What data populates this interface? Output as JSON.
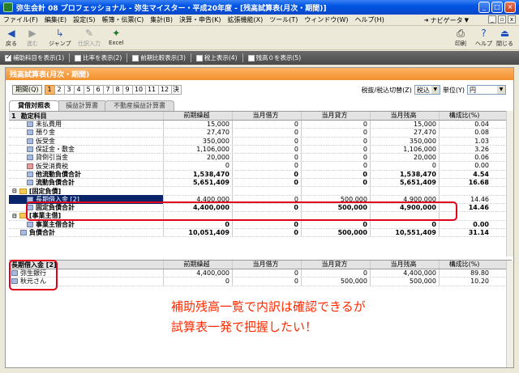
{
  "window": {
    "title": "弥生会計 08 プロフェッショナル - 弥生マイスター・平成20年度 - [残高試算表(月次・期間)]"
  },
  "menu": [
    "ファイル(F)",
    "編集(E)",
    "設定(S)",
    "帳簿・伝票(C)",
    "集計(B)",
    "決算・申告(K)",
    "拡張機能(X)",
    "ツール(T)",
    "ウィンドウ(W)",
    "ヘルプ(H)"
  ],
  "navigator": "ナビゲータ",
  "toolbar": {
    "back": "戻る",
    "forward": "進む",
    "jump": "ジャンプ",
    "open": "仕訳入力",
    "excel": "Excel",
    "print": "印刷",
    "help": "ヘルプ",
    "close": "閉じる"
  },
  "options": [
    "補助科目を表示(1)",
    "比率を表示(2)",
    "前期比較表示(3)",
    "税上表示(4)",
    "残高０を表示(5)"
  ],
  "panel_title": "残高試算表(月次・期間)",
  "period": {
    "button": "期間(Q)",
    "months": [
      "1",
      "2",
      "3",
      "4",
      "5",
      "6",
      "7",
      "8",
      "9",
      "10",
      "11",
      "12",
      "決"
    ]
  },
  "tax": {
    "label": "税抜/税込切替(Z)",
    "value": "税込",
    "unit_label": "単位(Y)",
    "unit_value": "円"
  },
  "tabs": [
    "貸借対照表",
    "損益計算書",
    "不動産損益計算書"
  ],
  "main": {
    "headers": [
      "勘定科目",
      "前期繰越",
      "当月借方",
      "当月貸方",
      "当月残高",
      "構成比(%)"
    ],
    "rows": [
      {
        "name": "未払費用",
        "v": [
          "15,000",
          "0",
          "0",
          "15,000",
          "0.04"
        ]
      },
      {
        "name": "預り金",
        "v": [
          "27,470",
          "0",
          "0",
          "27,470",
          "0.08"
        ]
      },
      {
        "name": "仮受金",
        "v": [
          "350,000",
          "0",
          "0",
          "350,000",
          "1.03"
        ]
      },
      {
        "name": "保証金・敷金",
        "v": [
          "1,106,000",
          "0",
          "0",
          "1,106,000",
          "3.26"
        ]
      },
      {
        "name": "貸倒引当金",
        "v": [
          "20,000",
          "0",
          "0",
          "20,000",
          "0.06"
        ]
      },
      {
        "name": "仮受消費税",
        "v": [
          "0",
          "0",
          "0",
          "0",
          "0.00"
        ]
      },
      {
        "name": "他流動負債合計",
        "v": [
          "1,538,470",
          "0",
          "0",
          "1,538,470",
          "4.54"
        ]
      },
      {
        "name": "流動負債合計",
        "v": [
          "5,651,409",
          "0",
          "0",
          "5,651,409",
          "16.68"
        ]
      },
      {
        "name": "[固定負債]",
        "v": [
          "",
          "",
          "",
          "",
          ""
        ]
      },
      {
        "name": "長期借入金 [2]",
        "v": [
          "4,400,000",
          "0",
          "500,000",
          "4,900,000",
          "14.46"
        ]
      },
      {
        "name": "固定負債合計",
        "v": [
          "4,400,000",
          "0",
          "500,000",
          "4,900,000",
          "14.46"
        ]
      },
      {
        "name": "[事業主借]",
        "v": [
          "",
          "",
          "",
          "",
          ""
        ]
      },
      {
        "name": "事業主借合計",
        "v": [
          "0",
          "0",
          "0",
          "0",
          "0.00"
        ]
      },
      {
        "name": "負債合計",
        "v": [
          "10,051,409",
          "0",
          "500,000",
          "10,551,409",
          "31.14"
        ]
      }
    ]
  },
  "sub": {
    "headers": [
      "長期借入金 [2]",
      "前期繰越",
      "当月借方",
      "当月貸方",
      "当月残高",
      "構成比(%)"
    ],
    "rows": [
      {
        "name": "弥生銀行",
        "v": [
          "4,400,000",
          "0",
          "0",
          "4,400,000",
          "89.80"
        ]
      },
      {
        "name": "秋元さん",
        "v": [
          "0",
          "0",
          "500,000",
          "500,000",
          "10.20"
        ]
      }
    ]
  },
  "annotation": [
    "補助残高一覧で内訳は確認できるが",
    "試算表一発で把握したい！"
  ]
}
